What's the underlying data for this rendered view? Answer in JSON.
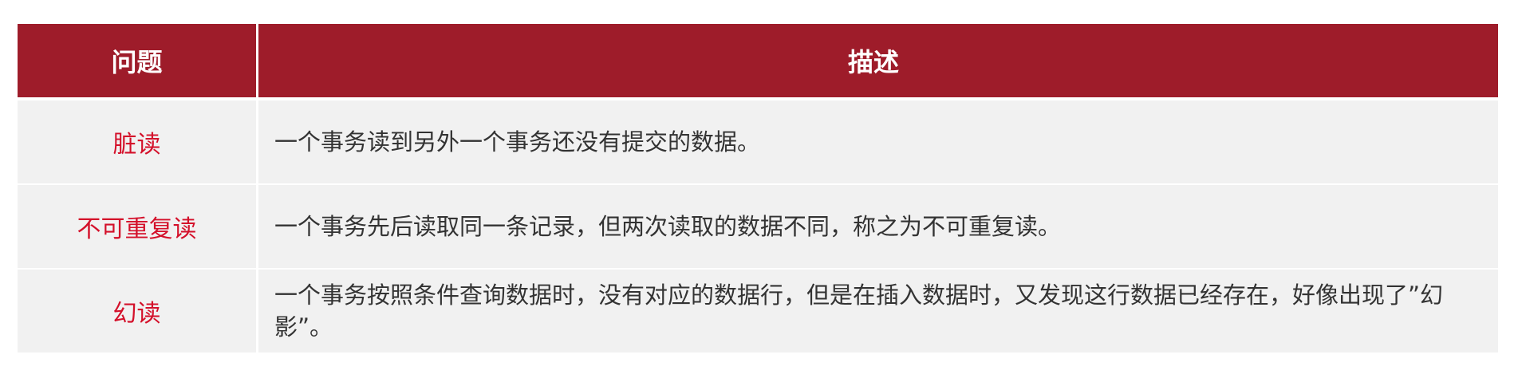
{
  "table": {
    "headers": {
      "issue": "问题",
      "description": "描述"
    },
    "rows": [
      {
        "issue": "脏读",
        "description": "一个事务读到另外一个事务还没有提交的数据。"
      },
      {
        "issue": "不可重复读",
        "description": "一个事务先后读取同一条记录，但两次读取的数据不同，称之为不可重复读。"
      },
      {
        "issue": "幻读",
        "description": "一个事务按照条件查询数据时，没有对应的数据行，但是在插入数据时，又发现这行数据已经存在，好像出现了”幻影”。"
      }
    ],
    "colors": {
      "header_background": "#9e1c2a",
      "header_text": "#ffffff",
      "issue_text": "#d4102a",
      "description_text": "#333333",
      "row_background": "#f1f1f1"
    }
  }
}
